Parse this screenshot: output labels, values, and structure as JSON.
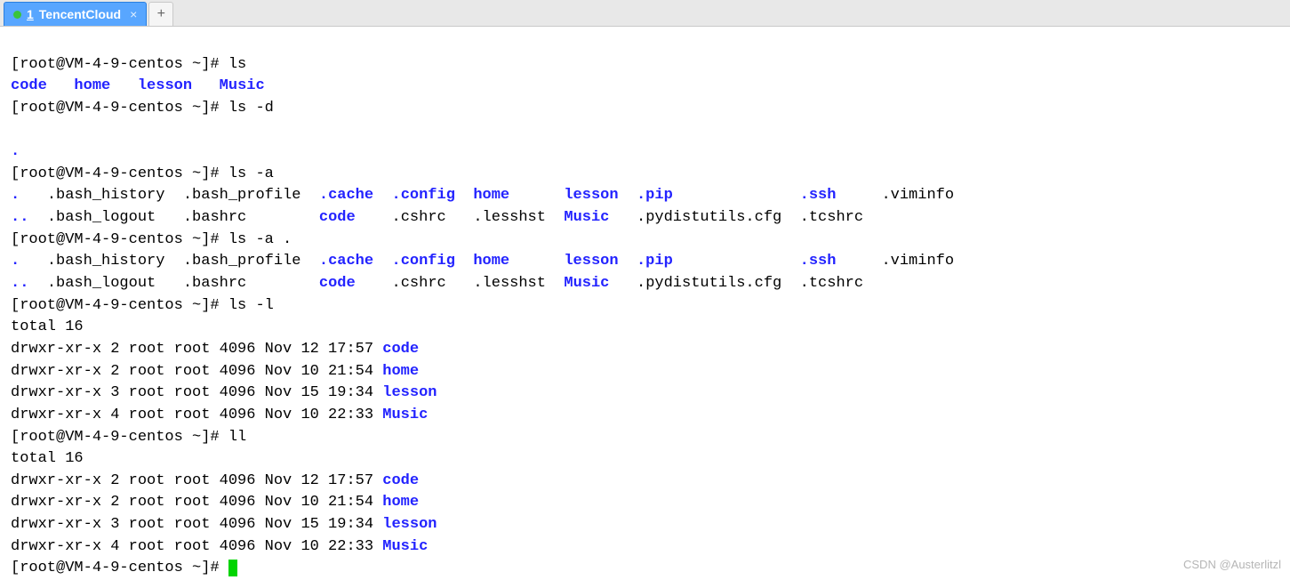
{
  "tab": {
    "index": "1",
    "title": "TencentCloud",
    "close": "×"
  },
  "newtab": "+",
  "prompt": "[root@VM-4-9-centos ~]# ",
  "cmds": {
    "ls": "ls",
    "ls_d": "ls -d",
    "ls_a": "ls -a",
    "ls_a_dot": "ls -a .",
    "ls_l": "ls -l",
    "ll": "ll"
  },
  "dirs": {
    "code": "code",
    "home": "home",
    "lesson": "lesson",
    "music": "Music"
  },
  "ls_out_sep1": "   ",
  "ls_out_sep2": "   ",
  "ls_out_sep3": "   ",
  "ls_d_out": ".",
  "lsa": {
    "r1": {
      "c1": ".",
      "c2": ".bash_history",
      "c3": ".bash_profile",
      "c4": ".cache",
      "c5": ".config",
      "c6": "home",
      "c7": "lesson",
      "c8": ".pip",
      "c9": ".ssh",
      "c10": ".viminfo"
    },
    "r2": {
      "c1": "..",
      "c2": ".bash_logout",
      "c3": ".bashrc",
      "c4": "code",
      "c5": ".cshrc",
      "c6": ".lesshst",
      "c7": "Music",
      "c8": ".pydistutils.cfg",
      "c9": ".tcshrc"
    }
  },
  "lsl": {
    "total": "total 16",
    "rows": {
      "r1": {
        "pre": "drwxr-xr-x 2 root root 4096 Nov 12 17:57 ",
        "dir": "code"
      },
      "r2": {
        "pre": "drwxr-xr-x 2 root root 4096 Nov 10 21:54 ",
        "dir": "home"
      },
      "r3": {
        "pre": "drwxr-xr-x 3 root root 4096 Nov 15 19:34 ",
        "dir": "lesson"
      },
      "r4": {
        "pre": "drwxr-xr-x 4 root root 4096 Nov 10 22:33 ",
        "dir": "Music"
      }
    }
  },
  "watermark": "CSDN @Austerlitzl"
}
